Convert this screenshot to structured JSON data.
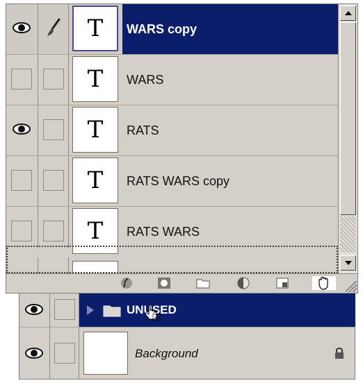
{
  "layers_panel": {
    "layers": [
      {
        "name": "WARS copy",
        "thumb_glyph": "T",
        "visible": true,
        "brush": true,
        "selected": true
      },
      {
        "name": "WARS",
        "thumb_glyph": "T",
        "visible": false,
        "brush": false,
        "selected": false
      },
      {
        "name": "RATS",
        "thumb_glyph": "T",
        "visible": true,
        "brush": false,
        "selected": false
      },
      {
        "name": "RATS WARS copy",
        "thumb_glyph": "T",
        "visible": false,
        "brush": false,
        "selected": false
      },
      {
        "name": "RATS WARS",
        "thumb_glyph": "T",
        "visible": false,
        "brush": false,
        "selected": false
      }
    ],
    "toolbar_icons": [
      "layer-style-icon",
      "mask-icon",
      "new-set-icon",
      "adjustment-layer-icon",
      "new-layer-icon",
      "hand-cursor-icon"
    ]
  },
  "set_panel": {
    "group": {
      "name": "UNUSED",
      "visible": true,
      "expanded": false
    },
    "background": {
      "name": "Background",
      "visible": true,
      "locked": true
    }
  },
  "colors": {
    "selection": "#0b1e6b",
    "panel_bg": "#d4d0c8"
  }
}
